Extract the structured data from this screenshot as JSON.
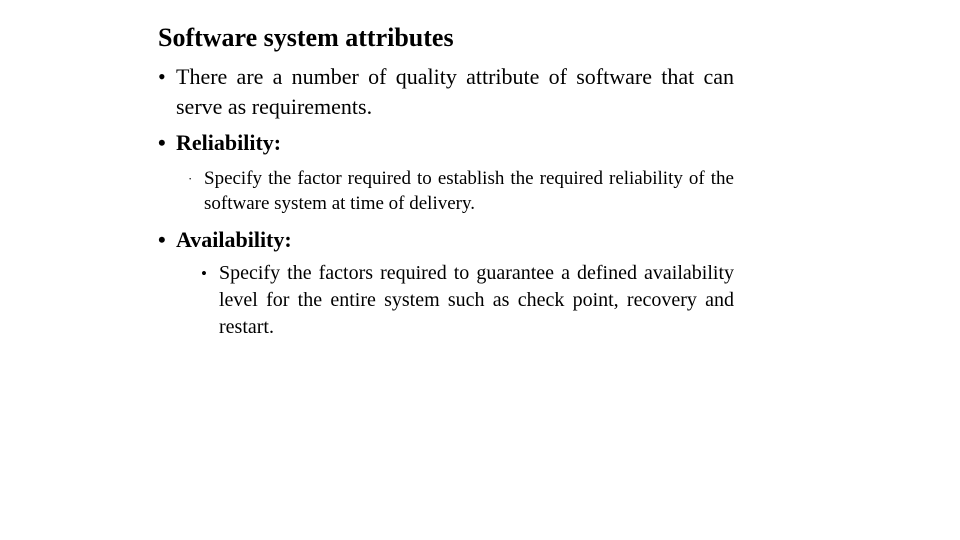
{
  "slide": {
    "title": "Software system attributes",
    "background_color": "#ffffff",
    "text_color": "#000000",
    "bullets": [
      {
        "level": 1,
        "marker": "•",
        "bold": false,
        "text": "There are a number of quality attribute of software that can serve as requirements."
      },
      {
        "level": 1,
        "marker": "•",
        "bold": true,
        "text": "Reliability:"
      },
      {
        "level": 2,
        "marker": "·",
        "bold": false,
        "text": "Specify the factor required to establish the required reliability of the software system at time of delivery."
      },
      {
        "level": 1,
        "marker": "•",
        "bold": true,
        "text": "Availability:"
      },
      {
        "level": 2,
        "marker": "•",
        "bold": false,
        "text": "Specify the factors required to guarantee a defined availability level for the entire system such as check point, recovery and restart."
      }
    ]
  }
}
